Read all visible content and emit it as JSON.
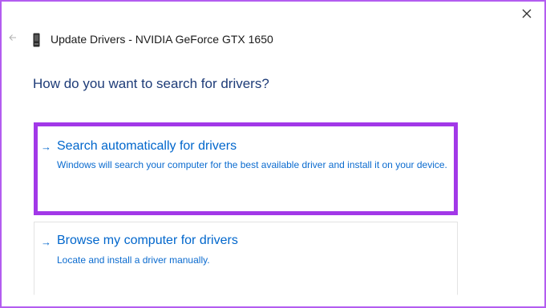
{
  "window": {
    "title": "Update Drivers - NVIDIA GeForce GTX 1650",
    "close_icon": "close-icon",
    "back_icon": "back-arrow-icon",
    "device_icon": "display-adapter-icon"
  },
  "main": {
    "question": "How do you want to search for drivers?",
    "options": [
      {
        "arrow": "→",
        "title": "Search automatically for drivers",
        "description": "Windows will search your computer for the best available driver and install it on your device."
      },
      {
        "arrow": "→",
        "title": "Browse my computer for drivers",
        "description": "Locate and install a driver manually."
      }
    ]
  },
  "colors": {
    "highlight_border": "#a238e8",
    "frame_border": "#b35cf0",
    "link_blue": "#0066cc",
    "heading_blue": "#1e3c78"
  }
}
